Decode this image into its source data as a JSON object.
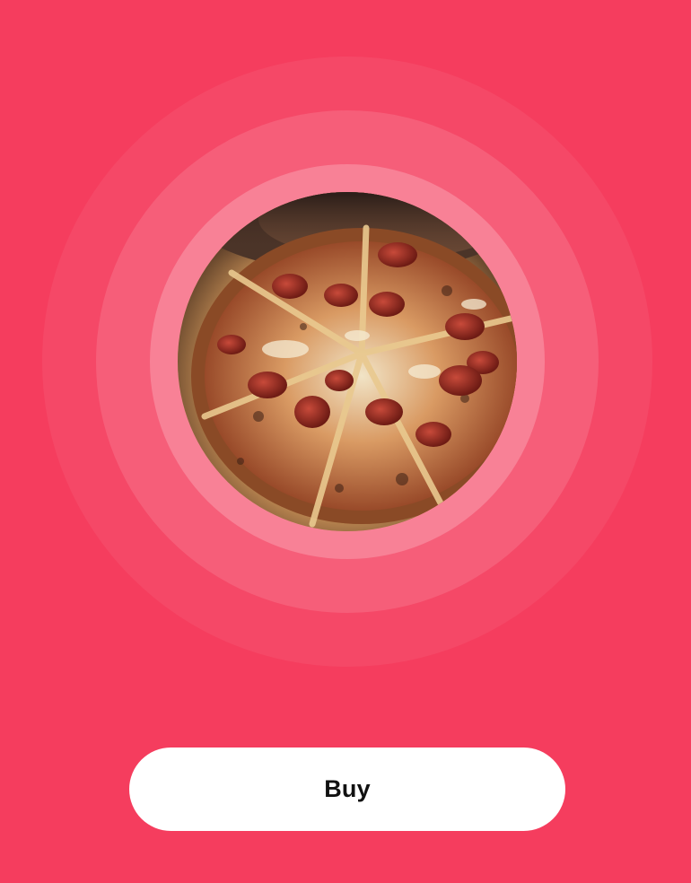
{
  "product": {
    "image_subject": "pepperoni-pizza"
  },
  "actions": {
    "buy_label": "Buy"
  },
  "colors": {
    "background": "#f53d5e",
    "button_background": "#ffffff",
    "button_text": "#111111"
  }
}
